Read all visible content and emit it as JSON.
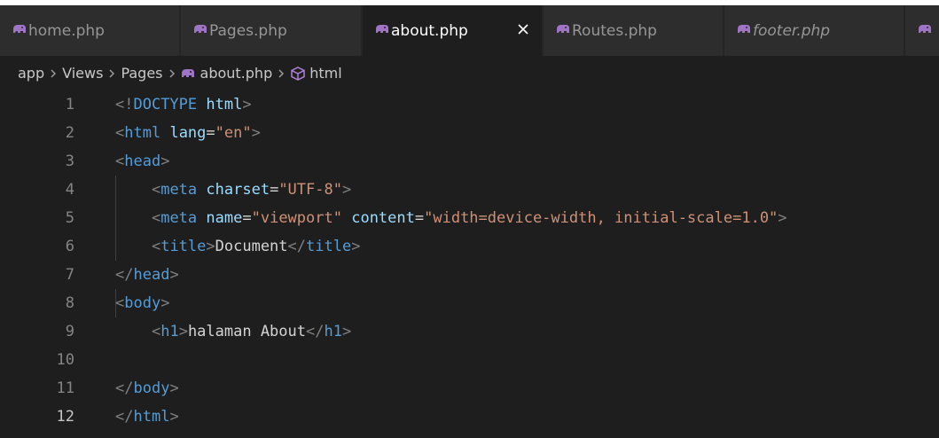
{
  "tabs": [
    {
      "label": "home.php",
      "active": false,
      "italic": false
    },
    {
      "label": "Pages.php",
      "active": false,
      "italic": false
    },
    {
      "label": "about.php",
      "active": true,
      "italic": false,
      "close_icon": "close-icon"
    },
    {
      "label": "Routes.php",
      "active": false,
      "italic": false
    },
    {
      "label": "footer.php",
      "active": false,
      "italic": true
    },
    {
      "label": "",
      "active": false,
      "italic": false
    }
  ],
  "breadcrumb": {
    "items": [
      "app",
      "Views",
      "Pages",
      "about.php",
      "html"
    ],
    "file_icon": "php-elephant-icon",
    "symbol_icon": "cube-icon"
  },
  "editor": {
    "lines": [
      {
        "n": "1",
        "tokens": [
          [
            "<!",
            "#808080"
          ],
          [
            "DOCTYPE",
            "#569cd6"
          ],
          [
            " ",
            "#d4d4d4"
          ],
          [
            "html",
            "#9cdcfe"
          ],
          [
            ">",
            "#808080"
          ]
        ]
      },
      {
        "n": "2",
        "tokens": [
          [
            "<",
            "#808080"
          ],
          [
            "html",
            "#569cd6"
          ],
          [
            " ",
            "#d4d4d4"
          ],
          [
            "lang",
            "#9cdcfe"
          ],
          [
            "=",
            "#d4d4d4"
          ],
          [
            "\"en\"",
            "#ce9178"
          ],
          [
            ">",
            "#808080"
          ]
        ]
      },
      {
        "n": "3",
        "tokens": [
          [
            "<",
            "#808080"
          ],
          [
            "head",
            "#569cd6"
          ],
          [
            ">",
            "#808080"
          ]
        ]
      },
      {
        "n": "4",
        "tokens": [
          [
            "    ",
            "#d4d4d4"
          ],
          [
            "<",
            "#808080"
          ],
          [
            "meta",
            "#569cd6"
          ],
          [
            " ",
            "#d4d4d4"
          ],
          [
            "charset",
            "#9cdcfe"
          ],
          [
            "=",
            "#d4d4d4"
          ],
          [
            "\"UTF-8\"",
            "#ce9178"
          ],
          [
            ">",
            "#808080"
          ]
        ]
      },
      {
        "n": "5",
        "tokens": [
          [
            "    ",
            "#d4d4d4"
          ],
          [
            "<",
            "#808080"
          ],
          [
            "meta",
            "#569cd6"
          ],
          [
            " ",
            "#d4d4d4"
          ],
          [
            "name",
            "#9cdcfe"
          ],
          [
            "=",
            "#d4d4d4"
          ],
          [
            "\"viewport\"",
            "#ce9178"
          ],
          [
            " ",
            "#d4d4d4"
          ],
          [
            "content",
            "#9cdcfe"
          ],
          [
            "=",
            "#d4d4d4"
          ],
          [
            "\"width=device-width, initial-scale=1.0\"",
            "#ce9178"
          ],
          [
            ">",
            "#808080"
          ]
        ]
      },
      {
        "n": "6",
        "tokens": [
          [
            "    ",
            "#d4d4d4"
          ],
          [
            "<",
            "#808080"
          ],
          [
            "title",
            "#569cd6"
          ],
          [
            ">",
            "#808080"
          ],
          [
            "Document",
            "#d4d4d4"
          ],
          [
            "</",
            "#808080"
          ],
          [
            "title",
            "#569cd6"
          ],
          [
            ">",
            "#808080"
          ]
        ]
      },
      {
        "n": "7",
        "tokens": [
          [
            "</",
            "#808080"
          ],
          [
            "head",
            "#569cd6"
          ],
          [
            ">",
            "#808080"
          ]
        ]
      },
      {
        "n": "8",
        "tokens": [
          [
            "<",
            "#808080"
          ],
          [
            "body",
            "#569cd6"
          ],
          [
            ">",
            "#808080"
          ]
        ]
      },
      {
        "n": "9",
        "tokens": [
          [
            "    ",
            "#d4d4d4"
          ],
          [
            "<",
            "#808080"
          ],
          [
            "h1",
            "#569cd6"
          ],
          [
            ">",
            "#808080"
          ],
          [
            "halaman About",
            "#d4d4d4"
          ],
          [
            "</",
            "#808080"
          ],
          [
            "h1",
            "#569cd6"
          ],
          [
            ">",
            "#808080"
          ]
        ]
      },
      {
        "n": "10",
        "tokens": []
      },
      {
        "n": "11",
        "tokens": [
          [
            "</",
            "#808080"
          ],
          [
            "body",
            "#569cd6"
          ],
          [
            ">",
            "#808080"
          ]
        ]
      },
      {
        "n": "12",
        "tokens": [
          [
            "</",
            "#808080"
          ],
          [
            "html",
            "#569cd6"
          ],
          [
            ">",
            "#808080"
          ]
        ]
      }
    ],
    "current_line": "12"
  },
  "colors": {
    "background": "#1e1e1e",
    "tabbar": "#252526",
    "tab_inactive": "#2d2d2d",
    "php_icon": "#a074c4"
  }
}
